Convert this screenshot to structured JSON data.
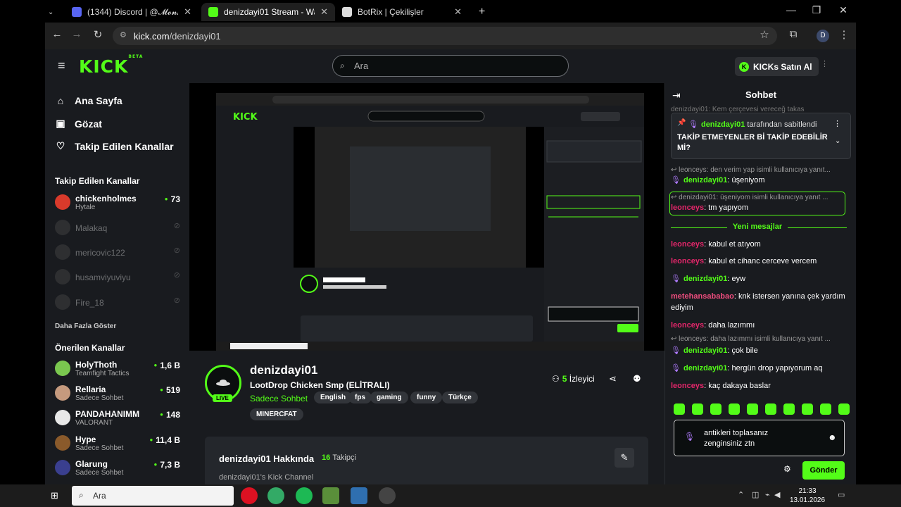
{
  "browser": {
    "tabs": [
      {
        "label": "(1344) Discord | @𝓜𝓸𝓷𝓴𝓮𝔂 𝓓",
        "icon": "discord-icon"
      },
      {
        "label": "denizdayi01 Stream - Watch Liv",
        "icon": "kick-icon"
      },
      {
        "label": "BotRix | Çekilişler",
        "icon": "botrix-icon"
      }
    ],
    "url_domain": "kick.com",
    "url_path": "/denizdayi01",
    "profile_initial": "D"
  },
  "kick": {
    "logo": "KICK",
    "logo_badge": "BETA",
    "search_placeholder": "Ara",
    "buy_kicks": "KICKs Satın Al"
  },
  "sidebar": {
    "nav": [
      "Ana Sayfa",
      "Gözat",
      "Takip Edilen Kanallar"
    ],
    "followed_title": "Takip Edilen Kanallar",
    "followed": [
      {
        "name": "chickenholmes",
        "category": "Hytale",
        "viewers": "73",
        "live": true
      },
      {
        "name": "Malakaq",
        "category": "",
        "viewers": "",
        "live": false
      },
      {
        "name": "mericovic122",
        "category": "",
        "viewers": "",
        "live": false
      },
      {
        "name": "husamviyuviyu",
        "category": "",
        "viewers": "",
        "live": false
      },
      {
        "name": "Fire_18",
        "category": "",
        "viewers": "",
        "live": false
      }
    ],
    "show_more": "Daha Fazla Göster",
    "recommended_title": "Önerilen Kanallar",
    "recommended": [
      {
        "name": "HolyThoth",
        "category": "Teamfight Tactics",
        "viewers": "1,6 B"
      },
      {
        "name": "Rellaria",
        "category": "Sadece Sohbet",
        "viewers": "519"
      },
      {
        "name": "PANDAHANIMM",
        "category": "VALORANT",
        "viewers": "148"
      },
      {
        "name": "Hype",
        "category": "Sadece Sohbet",
        "viewers": "11,4 B"
      },
      {
        "name": "Glarung",
        "category": "Sadece Sohbet",
        "viewers": "7,3 B"
      }
    ]
  },
  "stream": {
    "name": "denizdayi01",
    "title": "LootDrop Chicken Smp (ELİTRALI)",
    "category": "Sadece Sohbet",
    "tags": [
      "English",
      "fps",
      "gaming",
      "funny",
      "Türkçe",
      "MINERCFAT"
    ],
    "live": "LIVE",
    "viewers": "5",
    "viewers_label": "İzleyici",
    "about_title": "denizdayi01 Hakkında",
    "followers": "16",
    "followers_label": "Takipçi",
    "description": "denizdayi01's Kick Channel"
  },
  "chat": {
    "title": "Sohbet",
    "top_cut": "denizdayi01: Kem çerçevesi vereceğ takas",
    "pinned_by": "denizdayi01",
    "pinned_suffix": "tarafından sabitlendi",
    "pinned_msg": "TAKİP ETMEYENLER Bİ TAKİP EDEBİLİR Mİ?",
    "messages_a": [
      {
        "reply": "leonceys: den verim yap isimli kullanıcıya yanıt..."
      },
      {
        "user": "denizdayi01",
        "text": "üşeniyom",
        "color": "g",
        "mic": true
      },
      {
        "reply": "denizdayi01: üşeniyom isimli kullanıcıya yanıt ..."
      },
      {
        "user": "leonceys",
        "text": "tm yapıyom",
        "color": "r",
        "mic": false
      }
    ],
    "new_messages": "Yeni mesajlar",
    "messages_b": [
      {
        "user": "leonceys",
        "text": "kabul et atıyom",
        "color": "r",
        "mic": false
      },
      {
        "user": "leonceys",
        "text": "kabul et cihanc cerceve vercem",
        "color": "r",
        "mic": false
      },
      {
        "user": "denizdayi01",
        "text": "eyw",
        "color": "g",
        "mic": true
      },
      {
        "user": "metehansababao",
        "text": "knk istersen yanına çek yardım ediyim",
        "color": "m",
        "mic": false
      },
      {
        "user": "leonceys",
        "text": "daha lazımmı",
        "color": "r",
        "mic": false
      },
      {
        "reply": "leonceys: daha lazımmı isimli kullanıcıya yanıt ..."
      },
      {
        "user": "denizdayi01",
        "text": "çok bile",
        "color": "g",
        "mic": true
      },
      {
        "user": "denizdayi01",
        "text": "hergün drop yapıyorum aq",
        "color": "g",
        "mic": true
      },
      {
        "user": "leonceys",
        "text": "kaç dakaya baslar",
        "color": "r",
        "mic": false
      }
    ],
    "input_line1": "antikleri toplasanız",
    "input_line2": "zenginsiniz ztn",
    "send": "Gönder"
  },
  "taskbar": {
    "search_placeholder": "Ara",
    "time": "21:33",
    "date": "13.01.2026"
  },
  "colors": {
    "accent": "#53fc18",
    "bg": "#191b1f",
    "danger": "#e3266a"
  }
}
